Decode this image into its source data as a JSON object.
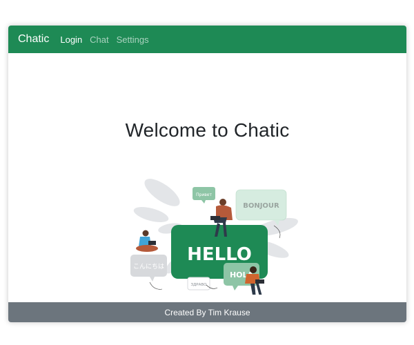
{
  "navbar": {
    "brand": "Chatic",
    "links": [
      {
        "label": "Login",
        "active": true
      },
      {
        "label": "Chat",
        "active": false
      },
      {
        "label": "Settings",
        "active": false
      }
    ]
  },
  "main": {
    "heading": "Welcome to Chatic",
    "illustration": {
      "bubbles": {
        "hello": "HELLO",
        "bonjour": "BONJOUR",
        "hola": "HOLA",
        "privet": "Привет",
        "zdravo": "ЗДРАВО",
        "japanese": "こんにちは"
      }
    }
  },
  "footer": {
    "text": "Created By Tim Krause"
  },
  "colors": {
    "navbar": "#1e8a55",
    "footer": "#6c757d",
    "bubble_main": "#1e8a55",
    "bubble_light": "#a9d6bd"
  }
}
